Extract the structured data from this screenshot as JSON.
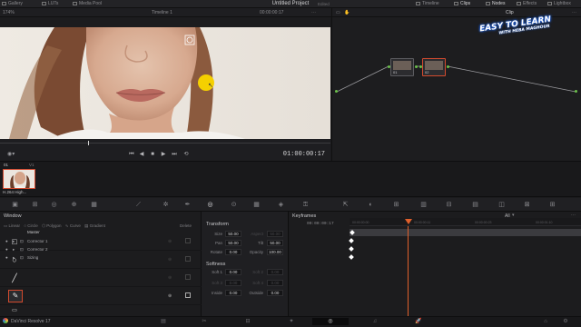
{
  "topbar": {
    "gallery": "Gallery",
    "luts": "LUTs",
    "media_pool": "Media Pool",
    "project_title": "Untitled Project",
    "project_status": "Edited",
    "timeline": "Timeline",
    "clips": "Clips",
    "nodes": "Nodes",
    "effects": "Effects",
    "lightbox": "Lightbox"
  },
  "viewer": {
    "zoom": "174%",
    "timeline_name": "Timeline 1",
    "timecode_top": "00:00:00:17",
    "timecode": "01:00:00:17"
  },
  "node_editor": {
    "mode": "Clip",
    "nodes": [
      {
        "label": "01"
      },
      {
        "label": "02"
      }
    ]
  },
  "watermark": {
    "line1": "EASY TO LEARN",
    "line2": "WITH HEBA MAGHOUR"
  },
  "clip_strip": {
    "clip_number": "01",
    "track": "V1",
    "codec": "H.264 High..."
  },
  "window_panel": {
    "title": "Window",
    "delete_label": "Delete",
    "shapes": [
      "Linear",
      "Circle",
      "Polygon",
      "Curve",
      "Gradient"
    ]
  },
  "transform_panel": {
    "title": "Transform",
    "fields": [
      {
        "label": "Size",
        "value": "50.00",
        "label2": "Aspect",
        "value2": "50.00"
      },
      {
        "label": "Pan",
        "value": "50.00",
        "label2": "Tilt",
        "value2": "50.00"
      },
      {
        "label": "Rotate",
        "value": "0.00",
        "label2": "Opacity",
        "value2": "100.00"
      }
    ],
    "softness_title": "Softness",
    "softness": [
      {
        "label": "Soft 1",
        "value": "0.00",
        "label2": "Soft 2",
        "value2": "0.00"
      },
      {
        "label": "Soft 3",
        "value": "0.00",
        "label2": "Soft 4",
        "value2": "0.00"
      },
      {
        "label": "Inside",
        "value": "0.00",
        "label2": "Outside",
        "value2": "0.00"
      }
    ]
  },
  "keyframes_panel": {
    "title": "Keyframes",
    "filter": "All",
    "current_tc": "00:00:00:17",
    "ruler": [
      "00:00:00:00",
      "00:00:00:11",
      "00:00:00:23",
      "00:00:01:10"
    ],
    "tracks": [
      "Master",
      "Corrector 1",
      "Corrector 2",
      "Sizing"
    ]
  },
  "statusbar": {
    "app_name": "DaVinci Resolve 17"
  },
  "colors": {
    "accent": "#e0602c",
    "cursor": "#f5d000"
  }
}
